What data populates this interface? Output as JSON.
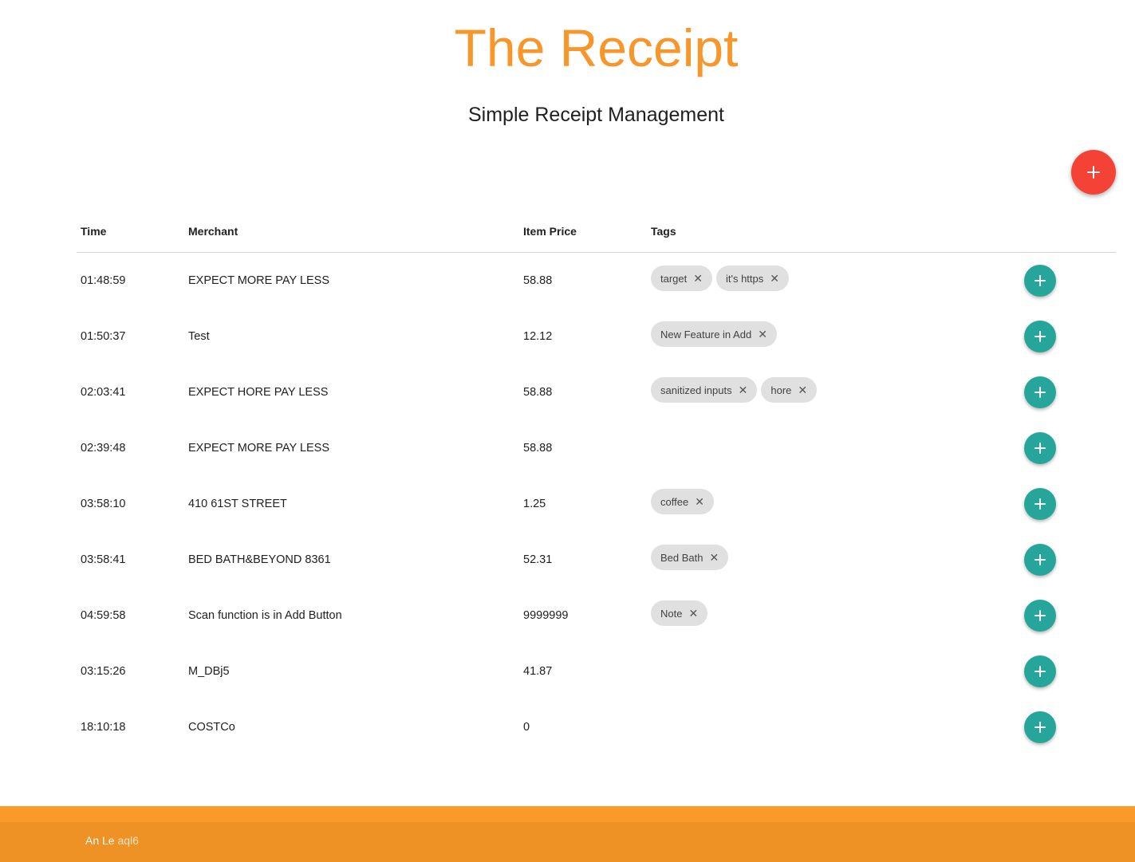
{
  "header": {
    "title": "The Receipt",
    "subtitle": "Simple Receipt Management"
  },
  "colors": {
    "title": "#f7962b",
    "fab": "#f44336",
    "row_button": "#26a69a",
    "chip": "#e0e0e0",
    "footer": "#ee9226"
  },
  "fab": {
    "icon": "plus-icon"
  },
  "table": {
    "columns": [
      "Time",
      "Merchant",
      "Item Price",
      "Tags"
    ],
    "rows": [
      {
        "time": "01:48:59",
        "merchant": "EXPECT MORE PAY LESS",
        "price": "58.88",
        "tags": [
          "target",
          "it's https"
        ]
      },
      {
        "time": "01:50:37",
        "merchant": "Test",
        "price": "12.12",
        "tags": [
          "New Feature in Add"
        ]
      },
      {
        "time": "02:03:41",
        "merchant": "EXPECT HORE PAY LESS",
        "price": "58.88",
        "tags": [
          "sanitized inputs",
          "hore"
        ]
      },
      {
        "time": "02:39:48",
        "merchant": "EXPECT MORE PAY LESS",
        "price": "58.88",
        "tags": []
      },
      {
        "time": "03:58:10",
        "merchant": "410 61ST STREET",
        "price": "1.25",
        "tags": [
          "coffee"
        ]
      },
      {
        "time": "03:58:41",
        "merchant": "BED BATH&BEYOND 8361",
        "price": "52.31",
        "tags": [
          "Bed Bath"
        ]
      },
      {
        "time": "04:59:58",
        "merchant": "Scan function is in Add Button",
        "price": "9999999",
        "tags": [
          "Note"
        ]
      },
      {
        "time": "03:15:26",
        "merchant": "M_DBj5",
        "price": "41.87",
        "tags": []
      },
      {
        "time": "18:10:18",
        "merchant": "COSTCo",
        "price": "0",
        "tags": []
      }
    ],
    "chip_remove_glyph": "✕",
    "row_button_icon": "plus-icon"
  },
  "footer": {
    "author": "An Le",
    "link": "aql6"
  }
}
